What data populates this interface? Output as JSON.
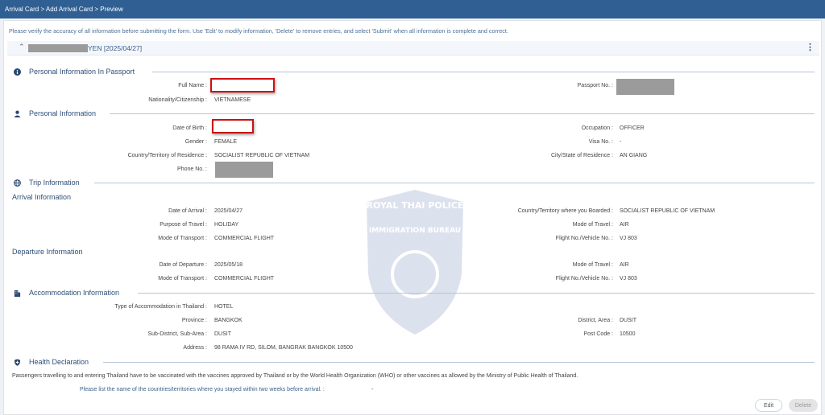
{
  "breadcrumb": "Arrival Card > Add Arrival Card > Preview",
  "intro": "Please verify the accuracy of all information before submitting the form. Use 'Edit' to modify information, 'Delete' to remove entries, and select 'Submit' when all information is complete and correct.",
  "record_header": {
    "name_suffix": "YEN [2025/04/27]",
    "collapse_icon": "chevron-up-icon",
    "menu_icon": "kebab-menu-icon"
  },
  "passport": {
    "title": "Personal Information In Passport",
    "icon": "info-icon",
    "full_name_label": "Full Name :",
    "nationality_label": "Nationality/Citizenship :",
    "nationality": "VIETNAMESE",
    "passport_no_label": "Passport No. :"
  },
  "personal": {
    "title": "Personal Information",
    "icon": "person-icon",
    "dob_label": "Date of Birth :",
    "gender_label": "Gender :",
    "gender": "FEMALE",
    "residence_label": "Country/Territory of Residence :",
    "residence": "SOCIALIST REPUBLIC OF VIETNAM",
    "phone_label": "Phone No. :",
    "occupation_label": "Occupation :",
    "occupation": "OFFICER",
    "visa_label": "Visa No. :",
    "visa": "-",
    "city_label": "City/State of Residence :",
    "city": "AN GIANG"
  },
  "trip": {
    "title": "Trip Information",
    "icon": "globe-icon",
    "arrival_title": "Arrival Information",
    "arrival_date_label": "Date of Arrival :",
    "arrival_date": "2025/04/27",
    "purpose_label": "Purpose of Travel :",
    "purpose": "HOLIDAY",
    "transport_label": "Mode of Transport :",
    "transport": "COMMERCIAL FLIGHT",
    "boarded_label": "Country/Territory where you Boarded :",
    "boarded": "SOCIALIST REPUBLIC OF VIETNAM",
    "travel_mode_label": "Mode of Travel :",
    "travel_mode": "AIR",
    "flight_label": "Flight No./Vehicle No. :",
    "flight": "VJ 803",
    "departure_title": "Departure Information",
    "departure_date_label": "Date of Departure :",
    "departure_date": "2025/05/18",
    "dep_transport_label": "Mode of Transport :",
    "dep_transport": "COMMERCIAL FLIGHT",
    "dep_travel_mode_label": "Mode of Travel :",
    "dep_travel_mode": "AIR",
    "dep_flight_label": "Flight No./Vehicle No. :",
    "dep_flight": "VJ 803"
  },
  "accommodation": {
    "title": "Accommodation Information",
    "icon": "building-icon",
    "type_label": "Type of Accommodation in Thailand :",
    "type": "HOTEL",
    "province_label": "Province :",
    "province": "BANGKOK",
    "subdistrict_label": "Sub-District, Sub-Area :",
    "subdistrict": "DUSIT",
    "address_label": "Address :",
    "address": "98 RAMA IV RD, SILOM, BANGRAK BANGKOK 10500",
    "district_label": "District, Area :",
    "district": "DUSIT",
    "postcode_label": "Post Code :",
    "postcode": "10500"
  },
  "health": {
    "title": "Health Declaration",
    "icon": "shield-icon",
    "text": "Passengers travelling to and entering Thailand have to be vaccinated with the vaccines approved by Thailand or by the World Health Organization (WHO) or other vaccines as allowed by the Ministry of Public Health of Thailand.",
    "stay_question": "Please list the name of the countries/territories where you stayed within two weeks before arrival. :",
    "stay_answer": "-"
  },
  "watermark_text": {
    "top": "ROYAL THAI POLICE",
    "middle": "IMMIGRATION BUREAU"
  },
  "buttons": {
    "edit": "Edit",
    "delete": "Delete"
  }
}
